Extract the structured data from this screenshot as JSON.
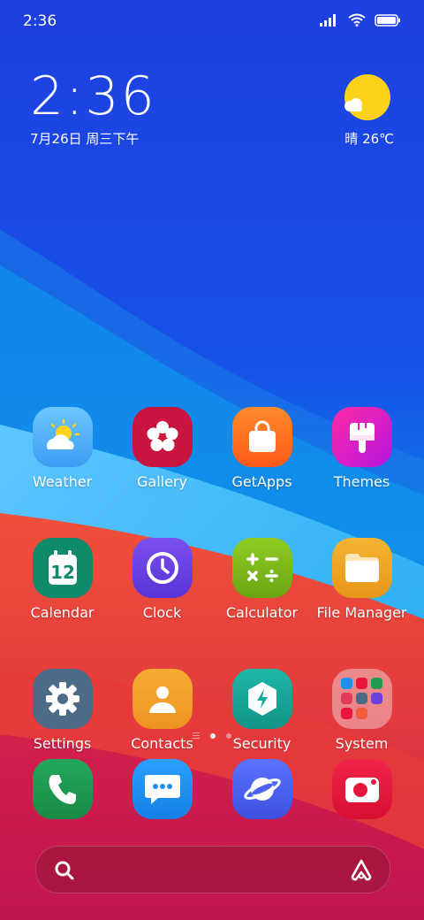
{
  "status_bar": {
    "time": "2:36",
    "icons": [
      "signal-icon",
      "wifi-icon",
      "battery-icon"
    ]
  },
  "clock_widget": {
    "time": "2:36",
    "date": "7月26日 周三下午"
  },
  "weather_widget": {
    "icon": "sunny-partly-cloudy-icon",
    "text": "晴 26℃"
  },
  "apps": [
    {
      "label": "Weather",
      "icon": "weather-icon",
      "color": "#5cb6ff"
    },
    {
      "label": "Gallery",
      "icon": "gallery-icon",
      "color": "#c9143f"
    },
    {
      "label": "GetApps",
      "icon": "getapps-icon",
      "color": "#ff6e1f"
    },
    {
      "label": "Themes",
      "icon": "themes-icon",
      "color": "#e21ec6"
    },
    {
      "label": "Calendar",
      "icon": "calendar-icon",
      "color": "#0f8a6a",
      "badge": "12"
    },
    {
      "label": "Clock",
      "icon": "clock-icon",
      "color": "#6a3fe0"
    },
    {
      "label": "Calculator",
      "icon": "calculator-icon",
      "color": "#7fbd19"
    },
    {
      "label": "File Manager",
      "icon": "folder-icon",
      "color": "#f0a520"
    },
    {
      "label": "Settings",
      "icon": "settings-icon",
      "color": "#4c6b86"
    },
    {
      "label": "Contacts",
      "icon": "contacts-icon",
      "color": "#f2a12a"
    },
    {
      "label": "Security",
      "icon": "security-icon",
      "color": "#17a99a"
    },
    {
      "label": "System",
      "icon": "system-folder-icon",
      "color": "#f3c6c9"
    }
  ],
  "page_indicator": {
    "pages": 2,
    "active": 1
  },
  "dock": [
    {
      "name": "phone",
      "icon": "phone-icon",
      "color": "#1e9a52"
    },
    {
      "name": "messages",
      "icon": "messages-icon",
      "color": "#1d8ff0"
    },
    {
      "name": "browser",
      "icon": "browser-icon",
      "color": "#4b62ee"
    },
    {
      "name": "camera",
      "icon": "camera-icon",
      "color": "#e8163c"
    }
  ],
  "search_bar": {
    "left_icon": "search-icon",
    "right_icon": "assistant-icon"
  }
}
